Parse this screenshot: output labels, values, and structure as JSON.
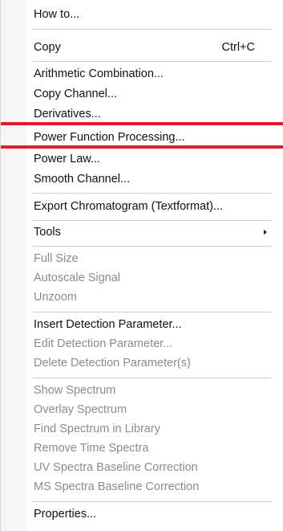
{
  "menu": {
    "how_to": "How to...",
    "copy": {
      "label": "Copy",
      "shortcut": "Ctrl+C"
    },
    "arithmetic_combination": "Arithmetic Combination...",
    "copy_channel": "Copy Channel...",
    "derivatives": "Derivatives...",
    "power_function_processing": "Power Function Processing...",
    "power_law": "Power Law...",
    "smooth_channel": "Smooth Channel...",
    "export_chromatogram": "Export Chromatogram (Textformat)...",
    "tools": "Tools",
    "full_size": "Full Size",
    "autoscale_signal": "Autoscale Signal",
    "unzoom": "Unzoom",
    "insert_detection_parameter": "Insert Detection Parameter...",
    "edit_detection_parameter": "Edit Detection Parameter...",
    "delete_detection_parameters": "Delete Detection Parameter(s)",
    "show_spectrum": "Show Spectrum",
    "overlay_spectrum": "Overlay Spectrum",
    "find_spectrum_in_library": "Find Spectrum in Library",
    "remove_time_spectra": "Remove Time Spectra",
    "uv_spectra_baseline_correction": "UV Spectra Baseline Correction",
    "ms_spectra_baseline_correction": "MS Spectra Baseline Correction",
    "properties": "Properties..."
  },
  "highlight_color": "#e21c2a"
}
